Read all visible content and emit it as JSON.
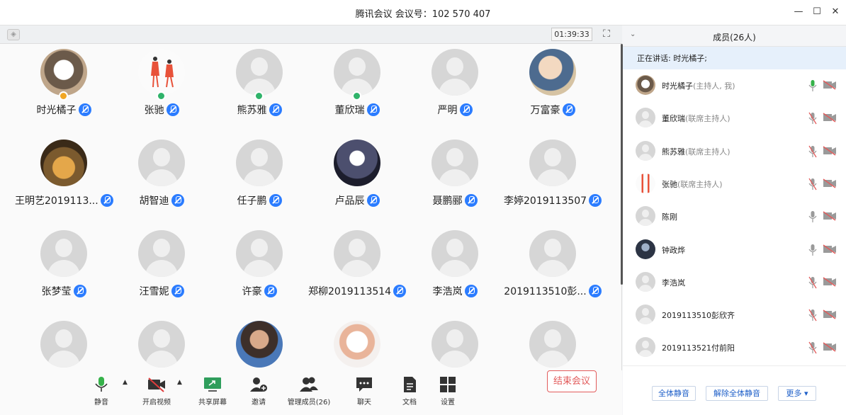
{
  "window": {
    "title": "腾讯会议 会议号：102 570 407"
  },
  "video_bar": {
    "timer": "01:39:33"
  },
  "gallery": {
    "tiles": [
      {
        "name": "时光橘子",
        "avatar": "photo-cat",
        "host": "orange"
      },
      {
        "name": "张驰",
        "avatar": "photo-figures",
        "host": "green"
      },
      {
        "name": "熊苏雅",
        "avatar": "default",
        "host": "green"
      },
      {
        "name": "董欣瑞",
        "avatar": "default",
        "host": "green"
      },
      {
        "name": "严明",
        "avatar": "default",
        "host": ""
      },
      {
        "name": "万富豪",
        "avatar": "photo-anime",
        "host": ""
      },
      {
        "name": "王明艺2019113...",
        "avatar": "photo-bears",
        "host": ""
      },
      {
        "name": "胡智迪",
        "avatar": "default",
        "host": ""
      },
      {
        "name": "任子鹏",
        "avatar": "default",
        "host": ""
      },
      {
        "name": "卢品辰",
        "avatar": "photo-poster",
        "host": ""
      },
      {
        "name": "聂鹏郦",
        "avatar": "default",
        "host": ""
      },
      {
        "name": "李婷2019113507",
        "avatar": "default",
        "host": ""
      },
      {
        "name": "张梦莹",
        "avatar": "default",
        "host": ""
      },
      {
        "name": "汪雪妮",
        "avatar": "default",
        "host": ""
      },
      {
        "name": "许豪",
        "avatar": "default",
        "host": ""
      },
      {
        "name": "郑柳2019113514",
        "avatar": "default",
        "host": ""
      },
      {
        "name": "李浩岚",
        "avatar": "default",
        "host": ""
      },
      {
        "name": "2019113510彭...",
        "avatar": "default",
        "host": ""
      },
      {
        "name": "",
        "avatar": "default",
        "host": ""
      },
      {
        "name": "",
        "avatar": "default",
        "host": ""
      },
      {
        "name": "",
        "avatar": "photo-person",
        "host": ""
      },
      {
        "name": "",
        "avatar": "photo-kitten",
        "host": ""
      },
      {
        "name": "",
        "avatar": "default",
        "host": ""
      },
      {
        "name": "",
        "avatar": "default",
        "host": ""
      }
    ]
  },
  "toolbar": {
    "mute": "静音",
    "video": "开启视频",
    "share": "共享屏幕",
    "invite": "邀请",
    "manage": "管理成员(26)",
    "chat": "聊天",
    "docs": "文档",
    "settings": "设置",
    "end": "结束会议"
  },
  "panel": {
    "title": "成员(26人)",
    "speaking": "正在讲话: 时光橘子;",
    "members": [
      {
        "name": "时光橘子",
        "role": "(主持人, 我)",
        "avatar": "photo-cat",
        "mic_on": true
      },
      {
        "name": "董欣瑞",
        "role": "(联席主持人)",
        "avatar": "default",
        "mic_on": false
      },
      {
        "name": "熊苏雅",
        "role": "(联席主持人)",
        "avatar": "default",
        "mic_on": false
      },
      {
        "name": "张驰",
        "role": "(联席主持人)",
        "avatar": "photo-figures",
        "mic_on": false
      },
      {
        "name": "陈刚",
        "role": "",
        "avatar": "default",
        "mic_on": true
      },
      {
        "name": "钟政烨",
        "role": "",
        "avatar": "photo-dark",
        "mic_on": true
      },
      {
        "name": "李浩岚",
        "role": "",
        "avatar": "default",
        "mic_on": false
      },
      {
        "name": "2019113510彭欣齐",
        "role": "",
        "avatar": "default",
        "mic_on": false
      },
      {
        "name": "2019113521付前阳",
        "role": "",
        "avatar": "default",
        "mic_on": false
      }
    ],
    "mute_all": "全体静音",
    "unmute_all": "解除全体静音",
    "more": "更多 ▾"
  },
  "colors": {
    "accent": "#2b7cff",
    "end": "#e25b5b",
    "host": "#2fb36a"
  }
}
